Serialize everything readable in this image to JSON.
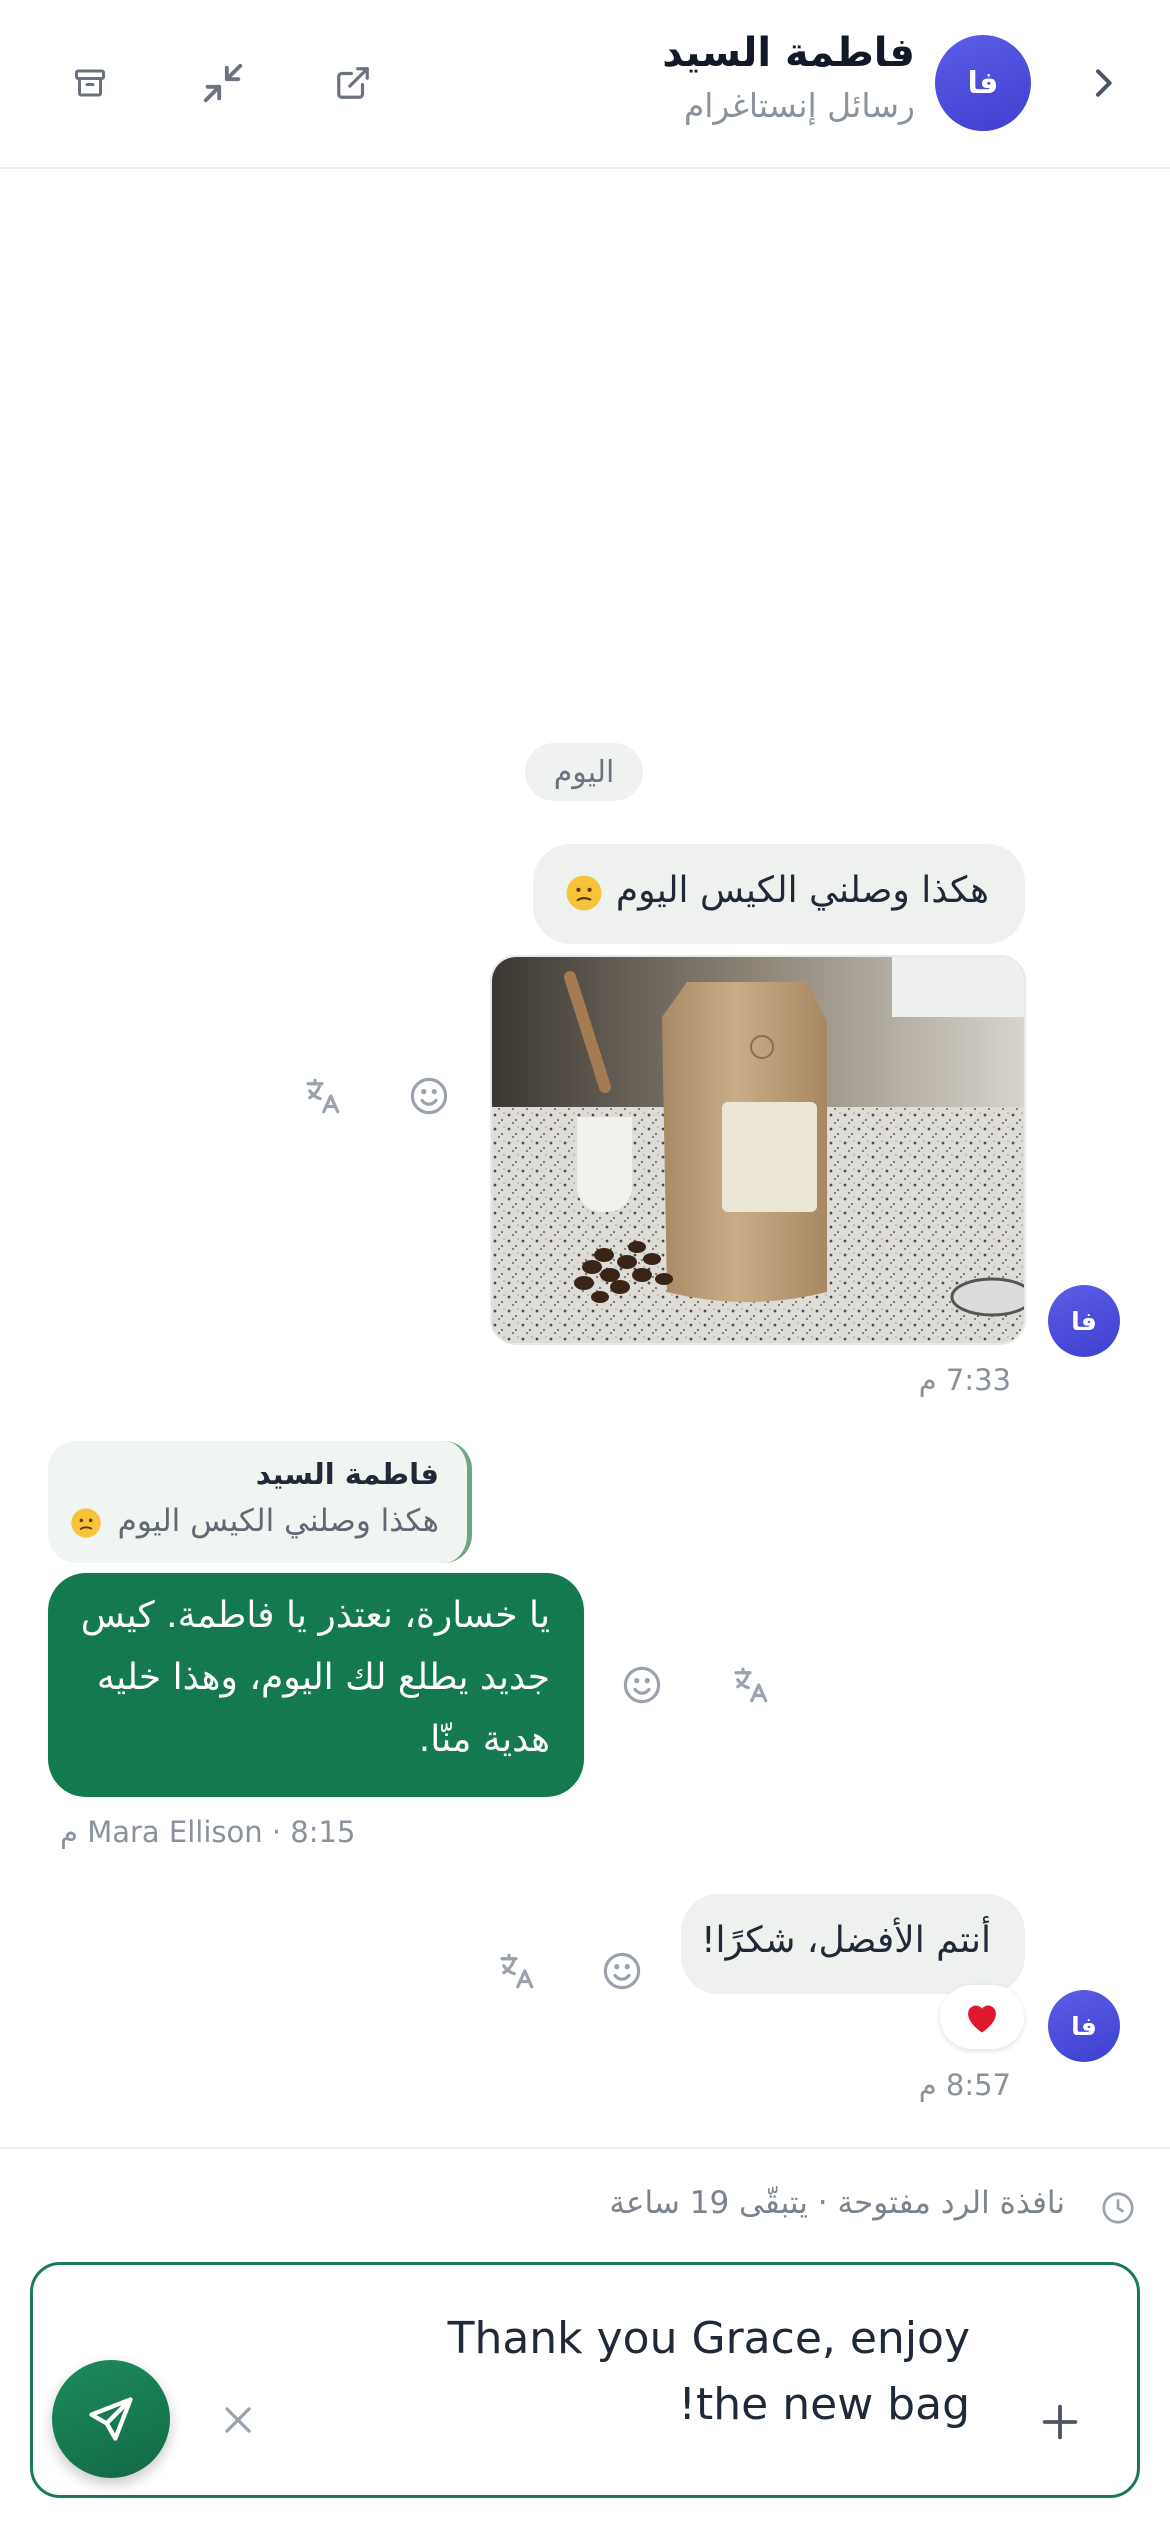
{
  "header": {
    "contact_name": "فاطمة السيد",
    "channel": "رسائل إنستاغرام",
    "avatar_initials": "فا"
  },
  "conversation": {
    "date_divider": "اليوم",
    "message1": {
      "text": "هكذا وصلني الكيس اليوم",
      "emoji": "confused-face",
      "image_description_icon": "coffee-bag-photo",
      "time": "7:33 م"
    },
    "reply": {
      "quoted_name": "فاطمة السيد",
      "quoted_text": "هكذا وصلني الكيس اليوم",
      "text": "يا خسارة، نعتذر يا فاطمة. كيس جديد يطلع لك اليوم، وهذا خليه هدية منّا.",
      "meta": "Mara Ellison · 8:15 م"
    },
    "message2": {
      "text": "أنتم الأفضل، شكرًا!",
      "reaction": "❤️",
      "time": "8:57 م"
    }
  },
  "composer": {
    "window_note": "نافذة الرد مفتوحة · يتبقّى 19 ساعة",
    "draft": "Thank you Grace, enjoy the new bag!"
  },
  "colors": {
    "accent_green": "#15794f",
    "avatar_purple": "#4f46e5",
    "incoming_bubble": "#eef1ee"
  }
}
